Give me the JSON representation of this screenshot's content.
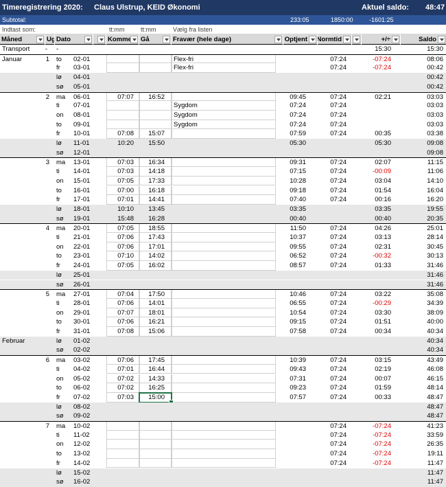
{
  "title": {
    "left": "Timeregistrering 2020:",
    "name": "Claus Ulstrup, KEID Økonomi",
    "balance_label": "Aktuel saldo:",
    "balance_value": "48:47"
  },
  "subtotal": {
    "label": "Subtotal:",
    "optjent": "233:05",
    "normtid": "1850:00",
    "diff": "-1601:25"
  },
  "hints": {
    "label": "Indtast som:",
    "kommet": "tt:mm",
    "gaa": "tt:mm",
    "fravaer": "Vælg fra listen"
  },
  "columns": [
    "Måned",
    "Ug",
    "Dato",
    "",
    "Kommet",
    "Gå",
    "Fravær (hele dage)",
    "Optjent",
    "Normtid",
    "",
    "+/÷",
    "Saldo"
  ],
  "transport": {
    "label": "Transport",
    "ug": "-",
    "dato": "-",
    "diff": "15:30",
    "saldo": "15:30"
  },
  "rows": [
    {
      "m": "Januar",
      "u": "1",
      "d": "to",
      "dt": "02-01",
      "k": "",
      "g": "",
      "f": "Flex-fri",
      "o": "",
      "n": "07:24",
      "p": "-07:24",
      "s": "08:06",
      "neg": true,
      "we": false,
      "top": true,
      "inp": true
    },
    {
      "m": "",
      "u": "",
      "d": "fr",
      "dt": "03-01",
      "k": "",
      "g": "",
      "f": "Flex-fri",
      "o": "",
      "n": "07:24",
      "p": "-07:24",
      "s": "00:42",
      "neg": true,
      "we": false,
      "top": false,
      "inp": true
    },
    {
      "m": "",
      "u": "",
      "d": "lø",
      "dt": "04-01",
      "k": "",
      "g": "",
      "f": "",
      "o": "",
      "n": "",
      "p": "",
      "s": "00:42",
      "neg": false,
      "we": true,
      "top": false,
      "inp": false
    },
    {
      "m": "",
      "u": "",
      "d": "sø",
      "dt": "05-01",
      "k": "",
      "g": "",
      "f": "",
      "o": "",
      "n": "",
      "p": "",
      "s": "00:42",
      "neg": false,
      "we": true,
      "top": false,
      "inp": false
    },
    {
      "m": "",
      "u": "2",
      "d": "ma",
      "dt": "06-01",
      "k": "07:07",
      "g": "16:52",
      "f": "",
      "o": "09:45",
      "n": "07:24",
      "p": "02:21",
      "s": "03:03",
      "neg": false,
      "we": false,
      "top": true,
      "inp": true
    },
    {
      "m": "",
      "u": "",
      "d": "ti",
      "dt": "07-01",
      "k": "",
      "g": "",
      "f": "Sygdom",
      "o": "07:24",
      "n": "07:24",
      "p": "",
      "s": "03:03",
      "neg": false,
      "we": false,
      "top": false,
      "inp": true
    },
    {
      "m": "",
      "u": "",
      "d": "on",
      "dt": "08-01",
      "k": "",
      "g": "",
      "f": "Sygdom",
      "o": "07:24",
      "n": "07:24",
      "p": "",
      "s": "03:03",
      "neg": false,
      "we": false,
      "top": false,
      "inp": true
    },
    {
      "m": "",
      "u": "",
      "d": "to",
      "dt": "09-01",
      "k": "",
      "g": "",
      "f": "Sygdom",
      "o": "07:24",
      "n": "07:24",
      "p": "",
      "s": "03:03",
      "neg": false,
      "we": false,
      "top": false,
      "inp": true
    },
    {
      "m": "",
      "u": "",
      "d": "fr",
      "dt": "10-01",
      "k": "07:08",
      "g": "15:07",
      "f": "",
      "o": "07:59",
      "n": "07:24",
      "p": "00:35",
      "s": "03:38",
      "neg": false,
      "we": false,
      "top": false,
      "inp": true
    },
    {
      "m": "",
      "u": "",
      "d": "lø",
      "dt": "11-01",
      "k": "10:20",
      "g": "15:50",
      "f": "",
      "o": "05:30",
      "n": "",
      "p": "05:30",
      "s": "09:08",
      "neg": false,
      "we": true,
      "top": false,
      "inp": false
    },
    {
      "m": "",
      "u": "",
      "d": "sø",
      "dt": "12-01",
      "k": "",
      "g": "",
      "f": "",
      "o": "",
      "n": "",
      "p": "",
      "s": "09:08",
      "neg": false,
      "we": true,
      "top": false,
      "inp": false
    },
    {
      "m": "",
      "u": "3",
      "d": "ma",
      "dt": "13-01",
      "k": "07:03",
      "g": "16:34",
      "f": "",
      "o": "09:31",
      "n": "07:24",
      "p": "02:07",
      "s": "11:15",
      "neg": false,
      "we": false,
      "top": true,
      "inp": true
    },
    {
      "m": "",
      "u": "",
      "d": "ti",
      "dt": "14-01",
      "k": "07:03",
      "g": "14:18",
      "f": "",
      "o": "07:15",
      "n": "07:24",
      "p": "-00:09",
      "s": "11:06",
      "neg": true,
      "we": false,
      "top": false,
      "inp": true
    },
    {
      "m": "",
      "u": "",
      "d": "on",
      "dt": "15-01",
      "k": "07:05",
      "g": "17:33",
      "f": "",
      "o": "10:28",
      "n": "07:24",
      "p": "03:04",
      "s": "14:10",
      "neg": false,
      "we": false,
      "top": false,
      "inp": true
    },
    {
      "m": "",
      "u": "",
      "d": "to",
      "dt": "16-01",
      "k": "07:00",
      "g": "16:18",
      "f": "",
      "o": "09:18",
      "n": "07:24",
      "p": "01:54",
      "s": "16:04",
      "neg": false,
      "we": false,
      "top": false,
      "inp": true
    },
    {
      "m": "",
      "u": "",
      "d": "fr",
      "dt": "17-01",
      "k": "07:01",
      "g": "14:41",
      "f": "",
      "o": "07:40",
      "n": "07:24",
      "p": "00:16",
      "s": "16:20",
      "neg": false,
      "we": false,
      "top": false,
      "inp": true
    },
    {
      "m": "",
      "u": "",
      "d": "lø",
      "dt": "18-01",
      "k": "10:10",
      "g": "13:45",
      "f": "",
      "o": "03:35",
      "n": "",
      "p": "03:35",
      "s": "19:55",
      "neg": false,
      "we": true,
      "top": false,
      "inp": false
    },
    {
      "m": "",
      "u": "",
      "d": "sø",
      "dt": "19-01",
      "k": "15:48",
      "g": "16:28",
      "f": "",
      "o": "00:40",
      "n": "",
      "p": "00:40",
      "s": "20:35",
      "neg": false,
      "we": true,
      "top": false,
      "inp": false
    },
    {
      "m": "",
      "u": "4",
      "d": "ma",
      "dt": "20-01",
      "k": "07:05",
      "g": "18:55",
      "f": "",
      "o": "11:50",
      "n": "07:24",
      "p": "04:26",
      "s": "25:01",
      "neg": false,
      "we": false,
      "top": true,
      "inp": true
    },
    {
      "m": "",
      "u": "",
      "d": "ti",
      "dt": "21-01",
      "k": "07:06",
      "g": "17:43",
      "f": "",
      "o": "10:37",
      "n": "07:24",
      "p": "03:13",
      "s": "28:14",
      "neg": false,
      "we": false,
      "top": false,
      "inp": true
    },
    {
      "m": "",
      "u": "",
      "d": "on",
      "dt": "22-01",
      "k": "07:06",
      "g": "17:01",
      "f": "",
      "o": "09:55",
      "n": "07:24",
      "p": "02:31",
      "s": "30:45",
      "neg": false,
      "we": false,
      "top": false,
      "inp": true
    },
    {
      "m": "",
      "u": "",
      "d": "to",
      "dt": "23-01",
      "k": "07:10",
      "g": "14:02",
      "f": "",
      "o": "06:52",
      "n": "07:24",
      "p": "-00:32",
      "s": "30:13",
      "neg": true,
      "we": false,
      "top": false,
      "inp": true
    },
    {
      "m": "",
      "u": "",
      "d": "fr",
      "dt": "24-01",
      "k": "07:05",
      "g": "16:02",
      "f": "",
      "o": "08:57",
      "n": "07:24",
      "p": "01:33",
      "s": "31:46",
      "neg": false,
      "we": false,
      "top": false,
      "inp": true
    },
    {
      "m": "",
      "u": "",
      "d": "lø",
      "dt": "25-01",
      "k": "",
      "g": "",
      "f": "",
      "o": "",
      "n": "",
      "p": "",
      "s": "31:46",
      "neg": false,
      "we": true,
      "top": false,
      "inp": false
    },
    {
      "m": "",
      "u": "",
      "d": "sø",
      "dt": "26-01",
      "k": "",
      "g": "",
      "f": "",
      "o": "",
      "n": "",
      "p": "",
      "s": "31:46",
      "neg": false,
      "we": true,
      "top": false,
      "inp": false
    },
    {
      "m": "",
      "u": "5",
      "d": "ma",
      "dt": "27-01",
      "k": "07:04",
      "g": "17:50",
      "f": "",
      "o": "10:46",
      "n": "07:24",
      "p": "03:22",
      "s": "35:08",
      "neg": false,
      "we": false,
      "top": true,
      "inp": true
    },
    {
      "m": "",
      "u": "",
      "d": "ti",
      "dt": "28-01",
      "k": "07:06",
      "g": "14:01",
      "f": "",
      "o": "06:55",
      "n": "07:24",
      "p": "-00:29",
      "s": "34:39",
      "neg": true,
      "we": false,
      "top": false,
      "inp": true
    },
    {
      "m": "",
      "u": "",
      "d": "on",
      "dt": "29-01",
      "k": "07:07",
      "g": "18:01",
      "f": "",
      "o": "10:54",
      "n": "07:24",
      "p": "03:30",
      "s": "38:09",
      "neg": false,
      "we": false,
      "top": false,
      "inp": true
    },
    {
      "m": "",
      "u": "",
      "d": "to",
      "dt": "30-01",
      "k": "07:06",
      "g": "16:21",
      "f": "",
      "o": "09:15",
      "n": "07:24",
      "p": "01:51",
      "s": "40:00",
      "neg": false,
      "we": false,
      "top": false,
      "inp": true
    },
    {
      "m": "",
      "u": "",
      "d": "fr",
      "dt": "31-01",
      "k": "07:08",
      "g": "15:06",
      "f": "",
      "o": "07:58",
      "n": "07:24",
      "p": "00:34",
      "s": "40:34",
      "neg": false,
      "we": false,
      "top": false,
      "inp": true
    },
    {
      "m": "Februar",
      "u": "",
      "d": "lø",
      "dt": "01-02",
      "k": "",
      "g": "",
      "f": "",
      "o": "",
      "n": "",
      "p": "",
      "s": "40:34",
      "neg": false,
      "we": true,
      "top": false,
      "inp": false
    },
    {
      "m": "",
      "u": "",
      "d": "sø",
      "dt": "02-02",
      "k": "",
      "g": "",
      "f": "",
      "o": "",
      "n": "",
      "p": "",
      "s": "40:34",
      "neg": false,
      "we": true,
      "top": false,
      "inp": false
    },
    {
      "m": "",
      "u": "6",
      "d": "ma",
      "dt": "03-02",
      "k": "07:06",
      "g": "17:45",
      "f": "",
      "o": "10:39",
      "n": "07:24",
      "p": "03:15",
      "s": "43:49",
      "neg": false,
      "we": false,
      "top": true,
      "inp": true
    },
    {
      "m": "",
      "u": "",
      "d": "ti",
      "dt": "04-02",
      "k": "07:01",
      "g": "16:44",
      "f": "",
      "o": "09:43",
      "n": "07:24",
      "p": "02:19",
      "s": "46:08",
      "neg": false,
      "we": false,
      "top": false,
      "inp": true
    },
    {
      "m": "",
      "u": "",
      "d": "on",
      "dt": "05-02",
      "k": "07:02",
      "g": "14:33",
      "f": "",
      "o": "07:31",
      "n": "07:24",
      "p": "00:07",
      "s": "46:15",
      "neg": false,
      "we": false,
      "top": false,
      "inp": true
    },
    {
      "m": "",
      "u": "",
      "d": "to",
      "dt": "06-02",
      "k": "07:02",
      "g": "16:25",
      "f": "",
      "o": "09:23",
      "n": "07:24",
      "p": "01:59",
      "s": "48:14",
      "neg": false,
      "we": false,
      "top": false,
      "inp": true
    },
    {
      "m": "",
      "u": "",
      "d": "fr",
      "dt": "07-02",
      "k": "07:03",
      "g": "15:00",
      "f": "",
      "o": "07:57",
      "n": "07:24",
      "p": "00:33",
      "s": "48:47",
      "neg": false,
      "we": false,
      "top": false,
      "inp": true,
      "selected": true
    },
    {
      "m": "",
      "u": "",
      "d": "lø",
      "dt": "08-02",
      "k": "",
      "g": "",
      "f": "",
      "o": "",
      "n": "",
      "p": "",
      "s": "48:47",
      "neg": false,
      "we": true,
      "top": false,
      "inp": false
    },
    {
      "m": "",
      "u": "",
      "d": "sø",
      "dt": "09-02",
      "k": "",
      "g": "",
      "f": "",
      "o": "",
      "n": "",
      "p": "",
      "s": "48:47",
      "neg": false,
      "we": true,
      "top": false,
      "inp": false
    },
    {
      "m": "",
      "u": "7",
      "d": "ma",
      "dt": "10-02",
      "k": "",
      "g": "",
      "f": "",
      "o": "",
      "n": "07:24",
      "p": "-07:24",
      "s": "41:23",
      "neg": true,
      "we": false,
      "top": true,
      "inp": true
    },
    {
      "m": "",
      "u": "",
      "d": "ti",
      "dt": "11-02",
      "k": "",
      "g": "",
      "f": "",
      "o": "",
      "n": "07:24",
      "p": "-07:24",
      "s": "33:59",
      "neg": true,
      "we": false,
      "top": false,
      "inp": true
    },
    {
      "m": "",
      "u": "",
      "d": "on",
      "dt": "12-02",
      "k": "",
      "g": "",
      "f": "",
      "o": "",
      "n": "07:24",
      "p": "-07:24",
      "s": "26:35",
      "neg": true,
      "we": false,
      "top": false,
      "inp": true
    },
    {
      "m": "",
      "u": "",
      "d": "to",
      "dt": "13-02",
      "k": "",
      "g": "",
      "f": "",
      "o": "",
      "n": "07:24",
      "p": "-07:24",
      "s": "19:11",
      "neg": true,
      "we": false,
      "top": false,
      "inp": true
    },
    {
      "m": "",
      "u": "",
      "d": "fr",
      "dt": "14-02",
      "k": "",
      "g": "",
      "f": "",
      "o": "",
      "n": "07:24",
      "p": "-07:24",
      "s": "11:47",
      "neg": true,
      "we": false,
      "top": false,
      "inp": true
    },
    {
      "m": "",
      "u": "",
      "d": "lø",
      "dt": "15-02",
      "k": "",
      "g": "",
      "f": "",
      "o": "",
      "n": "",
      "p": "",
      "s": "11:47",
      "neg": false,
      "we": true,
      "top": false,
      "inp": false
    },
    {
      "m": "",
      "u": "",
      "d": "sø",
      "dt": "16-02",
      "k": "",
      "g": "",
      "f": "",
      "o": "",
      "n": "",
      "p": "",
      "s": "11:47",
      "neg": false,
      "we": true,
      "top": false,
      "inp": false
    }
  ]
}
